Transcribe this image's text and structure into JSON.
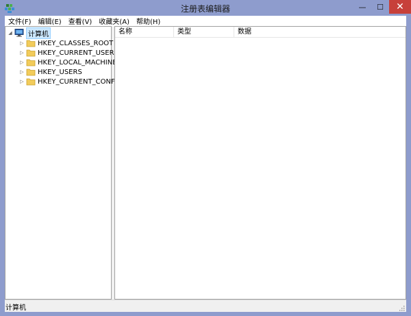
{
  "window": {
    "title": "注册表编辑器",
    "controls": {
      "minimize": "—",
      "maximize": "☐",
      "close": "✕"
    }
  },
  "menu": [
    {
      "label": "文件(F)"
    },
    {
      "label": "编辑(E)"
    },
    {
      "label": "查看(V)"
    },
    {
      "label": "收藏夹(A)"
    },
    {
      "label": "帮助(H)"
    }
  ],
  "tree": {
    "root": {
      "label": "计算机",
      "expander": "◢",
      "icon": "computer-icon"
    },
    "children": [
      {
        "label": "HKEY_CLASSES_ROOT",
        "expander": "▷",
        "icon": "folder-icon"
      },
      {
        "label": "HKEY_CURRENT_USER",
        "expander": "▷",
        "icon": "folder-icon"
      },
      {
        "label": "HKEY_LOCAL_MACHINE",
        "expander": "▷",
        "icon": "folder-icon"
      },
      {
        "label": "HKEY_USERS",
        "expander": "▷",
        "icon": "folder-icon"
      },
      {
        "label": "HKEY_CURRENT_CONFIG",
        "expander": "▷",
        "icon": "folder-icon"
      }
    ]
  },
  "list": {
    "columns": {
      "name": "名称",
      "type": "类型",
      "data": "数据"
    }
  },
  "status": {
    "text": "计算机"
  },
  "colors": {
    "frame": "#8e9ccd",
    "close_button": "#c7403a",
    "folder": "#f2cc5b",
    "selection": "#cce8ff"
  }
}
